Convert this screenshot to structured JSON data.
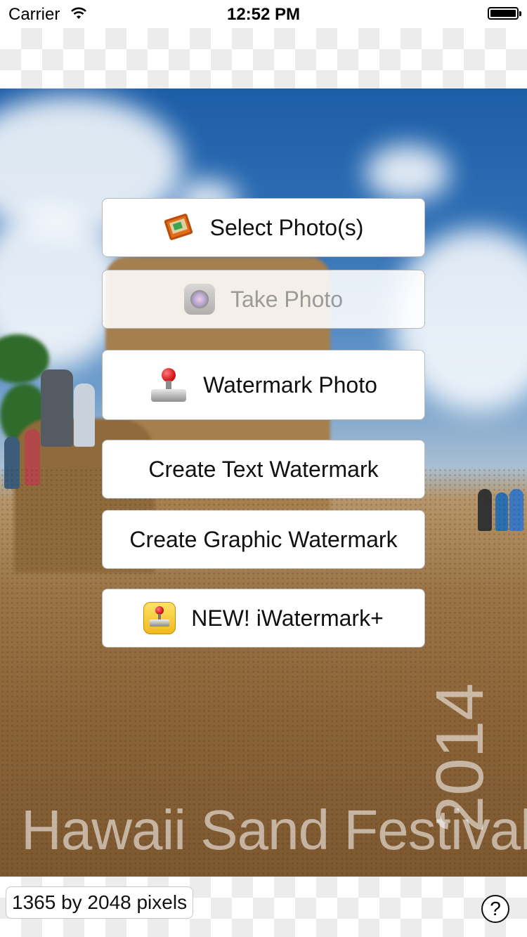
{
  "status_bar": {
    "carrier": "Carrier",
    "time": "12:52 PM",
    "icons": [
      "wifi-icon",
      "battery-icon"
    ]
  },
  "photo": {
    "overlay_title": "Hawaii Sand Festival",
    "overlay_year": "2014"
  },
  "menu": {
    "select_photos": {
      "label": "Select Photo(s)",
      "icon": "photo-album-icon"
    },
    "take_photo": {
      "label": "Take Photo",
      "icon": "camera-icon",
      "enabled": false
    },
    "watermark_photo": {
      "label": "Watermark Photo",
      "icon": "stamp-icon"
    },
    "create_text_watermark": {
      "label": "Create Text Watermark"
    },
    "create_graphic_watermark": {
      "label": "Create Graphic Watermark"
    },
    "iwatermark_plus": {
      "label": "NEW! iWatermark+",
      "icon": "iwatermark-app-icon"
    }
  },
  "bottom_bar": {
    "image_size": "1365 by 2048 pixels",
    "help_label": "?"
  },
  "colors": {
    "button_bg": "#ffffff",
    "button_border": "#b8b8b8",
    "disabled_text": "#9a9a9a"
  }
}
